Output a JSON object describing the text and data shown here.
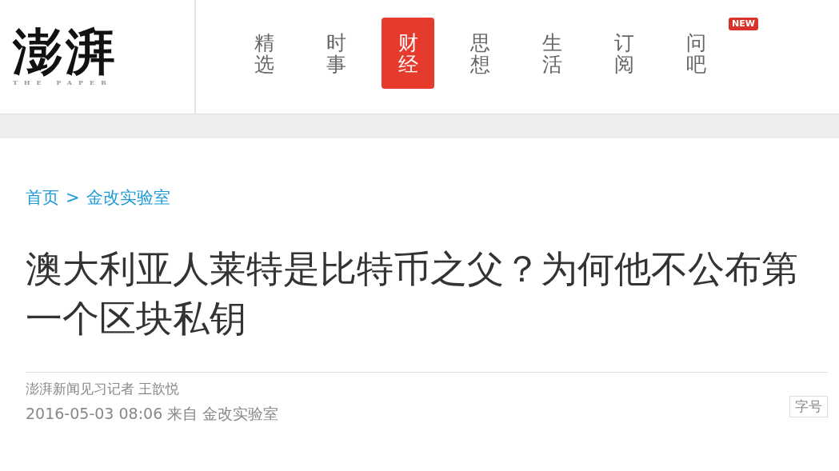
{
  "logo": {
    "name": "澎湃",
    "tagline": "THE PAPER"
  },
  "nav": [
    {
      "label": "精选",
      "selected": false
    },
    {
      "label": "时事",
      "selected": false
    },
    {
      "label": "财经",
      "selected": true
    },
    {
      "label": "思想",
      "selected": false
    },
    {
      "label": "生活",
      "selected": false
    },
    {
      "label": "订阅",
      "selected": false
    },
    {
      "label": "问吧",
      "selected": false,
      "badge": "NEW"
    }
  ],
  "breadcrumb": {
    "home": "首页",
    "separator": ">",
    "current": "金改实验室"
  },
  "article": {
    "title": "澳大利亚人莱特是比特币之父？为何他不公布第一个区块私钥",
    "author": "澎湃新闻见习记者 王歆悦",
    "date": "2016-05-03 08:06",
    "source_prefix": "来自",
    "source": "金改实验室",
    "font_size_button": "字号"
  }
}
